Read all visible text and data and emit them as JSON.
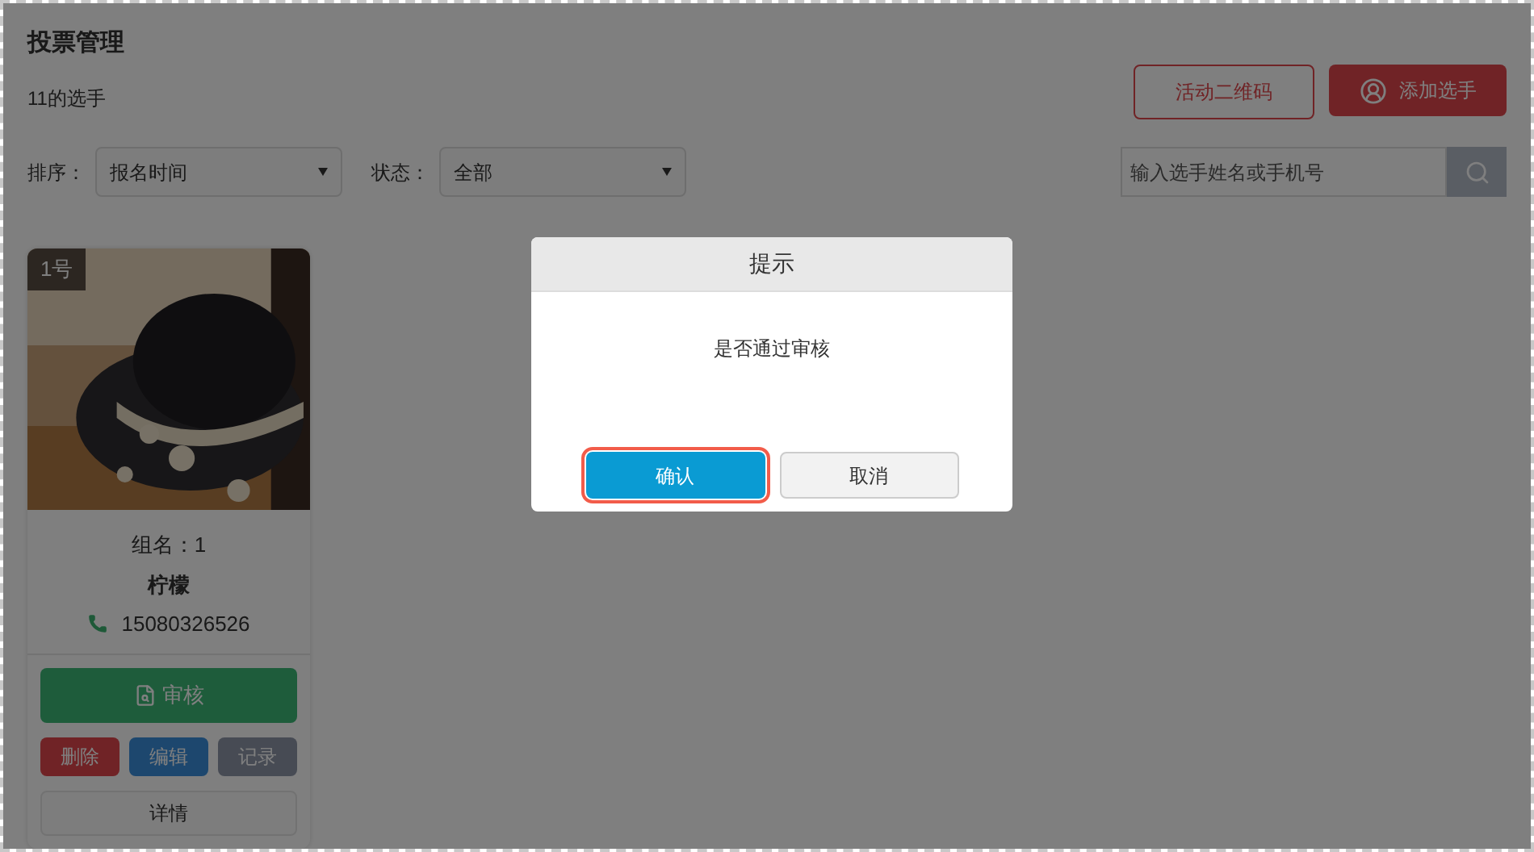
{
  "page": {
    "title": "投票管理",
    "subtitle": "11的选手"
  },
  "header_buttons": [
    {
      "label": "活动二维码",
      "kind": "outline"
    },
    {
      "label": "添加选手",
      "kind": "primary"
    }
  ],
  "filters": [
    {
      "label": "排序：",
      "value": "报名时间"
    },
    {
      "label": "状态：",
      "value": "全部"
    }
  ],
  "search": {
    "placeholder": "输入选手姓名或手机号"
  },
  "contestants": [
    {
      "number": "1号",
      "group": "组名：1",
      "name": "柠檬",
      "phone": "15080326526",
      "actions": [
        {
          "label": "审核",
          "kind": "review"
        },
        {
          "label": "删除",
          "kind": "delete"
        },
        {
          "label": "编辑",
          "kind": "edit"
        },
        {
          "label": "记录",
          "kind": "log"
        },
        {
          "label": "详情",
          "kind": "detail"
        }
      ]
    }
  ],
  "dialog": {
    "title": "提示",
    "message": "是否通过审核",
    "buttons": [
      {
        "label": "确认",
        "kind": "primary",
        "focused": true
      },
      {
        "label": "取消",
        "kind": "default",
        "focused": false
      }
    ]
  }
}
